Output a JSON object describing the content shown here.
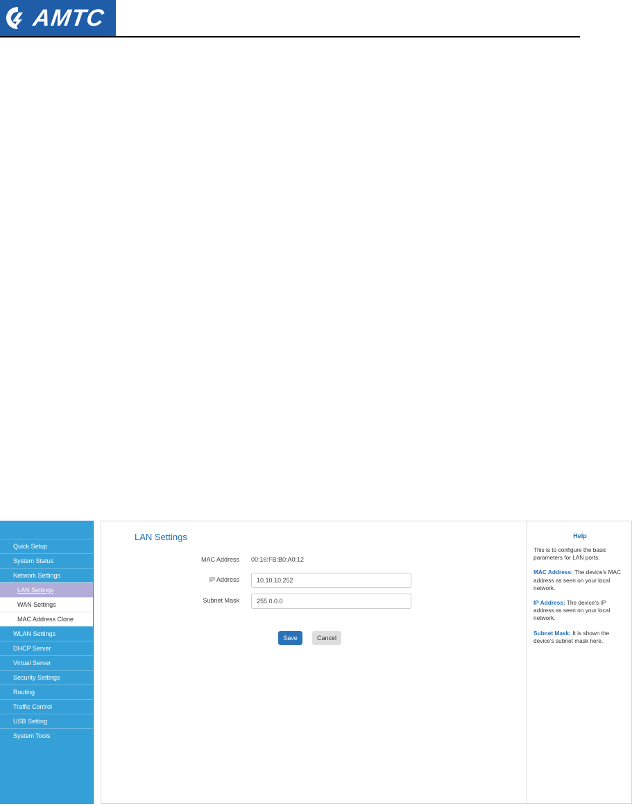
{
  "brand": {
    "logo_text": "AMTC",
    "colors": {
      "logo_bg": "#1f5da8",
      "sidebar": "#35a0d8",
      "active_item": "#b1acd8",
      "accent": "#1f6fb5",
      "save_button": "#2b73b8"
    }
  },
  "sidebar": {
    "items": [
      {
        "label": "Quick Setup"
      },
      {
        "label": "System Status"
      },
      {
        "label": "Network Settings",
        "children": [
          {
            "label": "LAN Settings",
            "active": true
          },
          {
            "label": "WAN Settings"
          },
          {
            "label": "MAC Address Clone"
          }
        ]
      },
      {
        "label": "WLAN Settings"
      },
      {
        "label": "DHCP Server"
      },
      {
        "label": "Virtual Server"
      },
      {
        "label": "Security Settings"
      },
      {
        "label": "Routing"
      },
      {
        "label": "Traffic Control"
      },
      {
        "label": "USB Setting"
      },
      {
        "label": "System Tools"
      }
    ]
  },
  "main": {
    "title": "LAN Settings",
    "mac": {
      "label": "MAC Address",
      "value": "00:16:FB:B0:A0:12"
    },
    "ip": {
      "label": "IP Address",
      "value": "10.10.10.252"
    },
    "mask": {
      "label": "Subnet Mask",
      "value": "255.0.0.0"
    },
    "save_label": "Save",
    "cancel_label": "Cancel"
  },
  "help": {
    "title": "Help",
    "intro": "This is to configure the basic parameters for LAN ports.",
    "entries": [
      {
        "term": "MAC Address:",
        "text": " The device's MAC address as seen on your local network."
      },
      {
        "term": "IP Address:",
        "text": " The device's IP address as seen on your local network."
      },
      {
        "term": "Subnet Mask:",
        "text": " It is shown the device's subnet mask here."
      }
    ]
  }
}
